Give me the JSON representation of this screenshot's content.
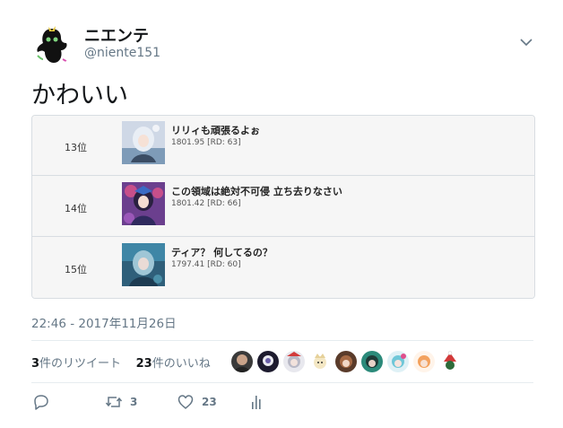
{
  "user": {
    "display_name": "ニエンテ",
    "handle": "@niente151",
    "avatar_icon": "ghost-character-avatar"
  },
  "tweet": {
    "text": "かわいい",
    "timestamp": "22:46 - 2017年11月26日"
  },
  "embed": {
    "rows": [
      {
        "rank": "13位",
        "title": "リリィも頑張るよぉ",
        "score": "1801.95 [RD: 63]"
      },
      {
        "rank": "14位",
        "title": "この領域は絶対不可侵 立ち去りなさい",
        "score": "1801.42 [RD: 66]"
      },
      {
        "rank": "15位",
        "title": "ティア？ 何してるの？",
        "score": "1797.41 [RD: 60]"
      }
    ]
  },
  "stats": {
    "retweet_count": "3",
    "retweet_label": "件のリツイート",
    "like_count": "23",
    "like_label": "件のいいね"
  },
  "actions": {
    "reply_icon": "reply-icon",
    "retweet_icon": "retweet-icon",
    "retweet_count": "3",
    "like_icon": "heart-icon",
    "like_count": "23",
    "analytics_icon": "analytics-icon"
  },
  "colors": {
    "text_primary": "#14171a",
    "text_secondary": "#657786",
    "border": "#e6ecf0"
  }
}
